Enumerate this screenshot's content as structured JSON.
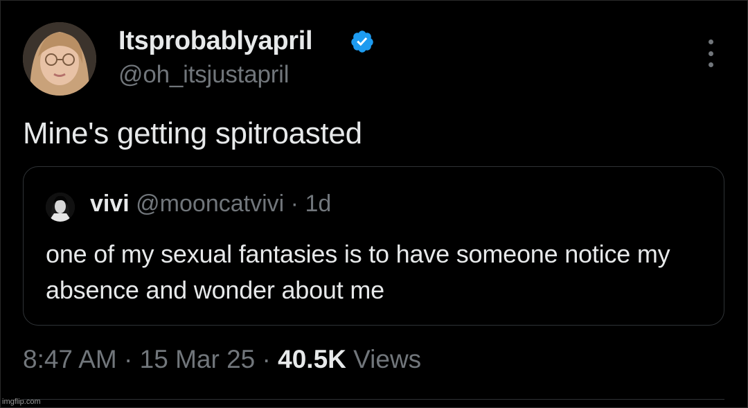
{
  "author": {
    "name": "Itsprobablyapril",
    "handle": "@oh_itsjustapril",
    "verified_icon": "verified-badge-icon",
    "verified_color": "#1d9bf0"
  },
  "tweet": {
    "text": "Mine's getting spitroasted"
  },
  "quoted": {
    "name": "vivi",
    "handle": "@mooncatvivi",
    "separator": "·",
    "time": "1d",
    "text": "one of my sexual fantasies is to have someone notice my absence and wonder about me"
  },
  "meta": {
    "time": "8:47 AM",
    "sep1": "·",
    "date": "15 Mar 25",
    "sep2": "·",
    "views_count": "40.5K",
    "views_label": "Views"
  },
  "watermark": "imgflip.com",
  "menu_icon": "more-vertical-icon",
  "colors": {
    "background": "#000000",
    "text_primary": "#e7e9ea",
    "text_secondary": "#71767b",
    "border": "#2f3336"
  }
}
